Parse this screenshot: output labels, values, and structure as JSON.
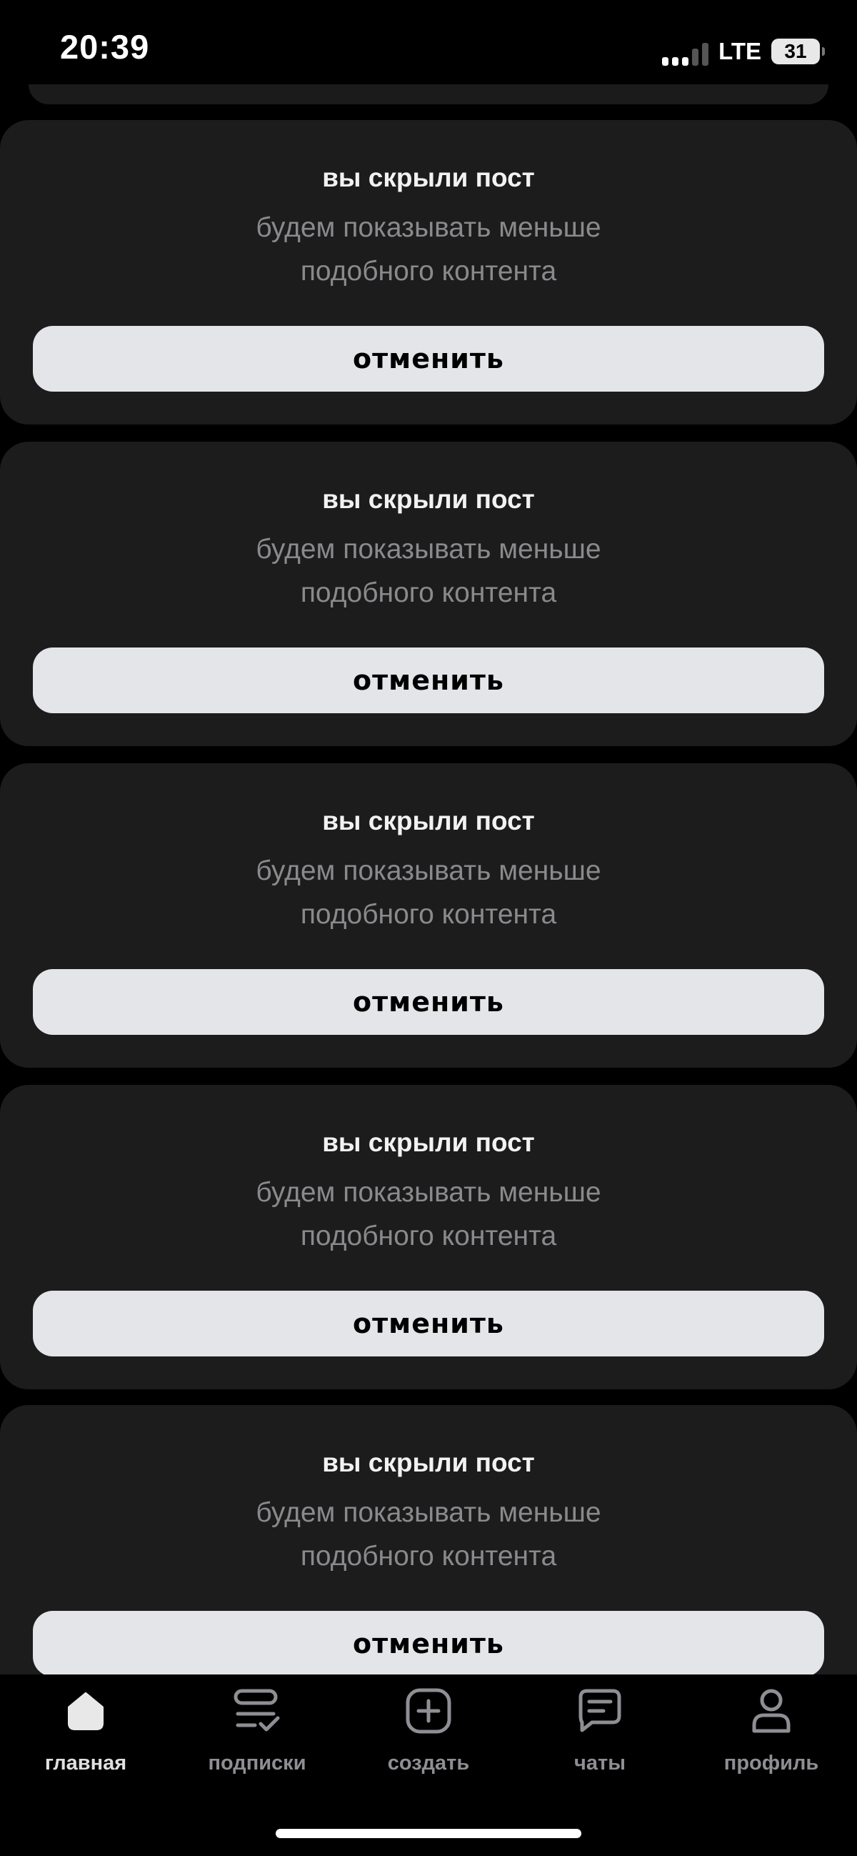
{
  "status_bar": {
    "time": "20:39",
    "network": "LTE",
    "battery": "31",
    "signal_icon": "signal-icon"
  },
  "hidden_posts": [
    {
      "title": "вы скрыли пост",
      "subtitle_line1": "будем показывать меньше",
      "subtitle_line2": "подобного контента",
      "button_label": "отменить"
    },
    {
      "title": "вы скрыли пост",
      "subtitle_line1": "будем показывать меньше",
      "subtitle_line2": "подобного контента",
      "button_label": "отменить"
    },
    {
      "title": "вы скрыли пост",
      "subtitle_line1": "будем показывать меньше",
      "subtitle_line2": "подобного контента",
      "button_label": "отменить"
    },
    {
      "title": "вы скрыли пост",
      "subtitle_line1": "будем показывать меньше",
      "subtitle_line2": "подобного контента",
      "button_label": "отменить"
    },
    {
      "title": "вы скрыли пост",
      "subtitle_line1": "будем показывать меньше",
      "subtitle_line2": "подобного контента",
      "button_label": "отменить"
    }
  ],
  "bottom_nav": {
    "items": [
      {
        "label": "главная",
        "icon": "home-icon",
        "active": true
      },
      {
        "label": "подписки",
        "icon": "subscriptions-icon",
        "active": false
      },
      {
        "label": "создать",
        "icon": "create-icon",
        "active": false
      },
      {
        "label": "чаты",
        "icon": "chat-icon",
        "active": false
      },
      {
        "label": "профиль",
        "icon": "profile-icon",
        "active": false
      }
    ]
  },
  "colors": {
    "background": "#000000",
    "card": "#1c1c1d",
    "button": "#e4e5e9",
    "secondary_text": "#8a8a8d"
  }
}
